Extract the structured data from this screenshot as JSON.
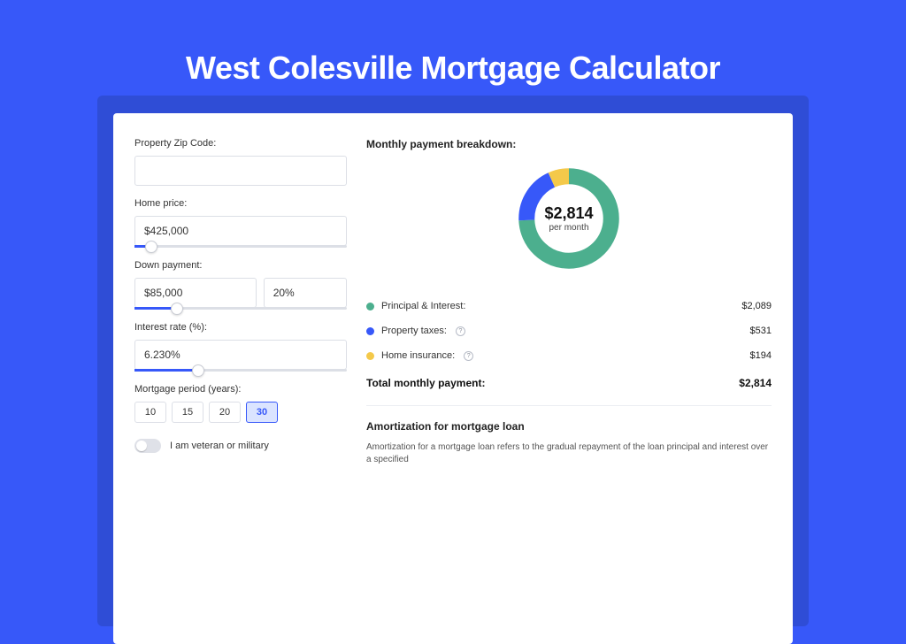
{
  "title": "West Colesville Mortgage Calculator",
  "left": {
    "zip_label": "Property Zip Code:",
    "zip_value": "",
    "price_label": "Home price:",
    "price_value": "$425,000",
    "price_slider_pct": 8,
    "down_label": "Down payment:",
    "down_amount": "$85,000",
    "down_pct": "20%",
    "down_slider_pct": 20,
    "rate_label": "Interest rate (%):",
    "rate_value": "6.230%",
    "rate_slider_pct": 30,
    "period_label": "Mortgage period (years):",
    "periods": [
      "10",
      "15",
      "20",
      "30"
    ],
    "period_selected": "30",
    "vet_label": "I am veteran or military"
  },
  "right": {
    "breakdown_title": "Monthly payment breakdown:",
    "donut_amount": "$2,814",
    "donut_sub": "per month",
    "items": [
      {
        "label": "Principal & Interest:",
        "value": "$2,089",
        "color": "#4caf8e",
        "help": false
      },
      {
        "label": "Property taxes:",
        "value": "$531",
        "color": "#3758f9",
        "help": true
      },
      {
        "label": "Home insurance:",
        "value": "$194",
        "color": "#f4c94a",
        "help": true
      }
    ],
    "total_label": "Total monthly payment:",
    "total_value": "$2,814",
    "amort_title": "Amortization for mortgage loan",
    "amort_text": "Amortization for a mortgage loan refers to the gradual repayment of the loan principal and interest over a specified"
  },
  "chart_data": {
    "type": "pie",
    "title": "Monthly payment breakdown",
    "series": [
      {
        "name": "Principal & Interest",
        "value": 2089,
        "color": "#4caf8e"
      },
      {
        "name": "Property taxes",
        "value": 531,
        "color": "#3758f9"
      },
      {
        "name": "Home insurance",
        "value": 194,
        "color": "#f4c94a"
      }
    ],
    "total": 2814,
    "center_label": "$2,814 per month"
  }
}
